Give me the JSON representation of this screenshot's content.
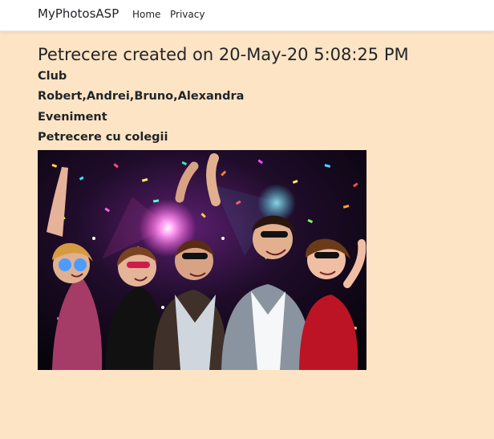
{
  "navbar": {
    "brand": "MyPhotosASP",
    "links": [
      {
        "label": "Home"
      },
      {
        "label": "Privacy"
      }
    ]
  },
  "album": {
    "title": "Petrecere created on 20-May-20 5:08:25 PM",
    "location_type": "Club",
    "people": "Robert,Andrei,Bruno,Alexandra",
    "category": "Eveniment",
    "description": "Petrecere cu colegii"
  },
  "photo": {
    "subject": "party-photo"
  },
  "colors": {
    "page_background": "#fde4c4",
    "navbar_background": "#ffffff",
    "text": "#212529"
  }
}
